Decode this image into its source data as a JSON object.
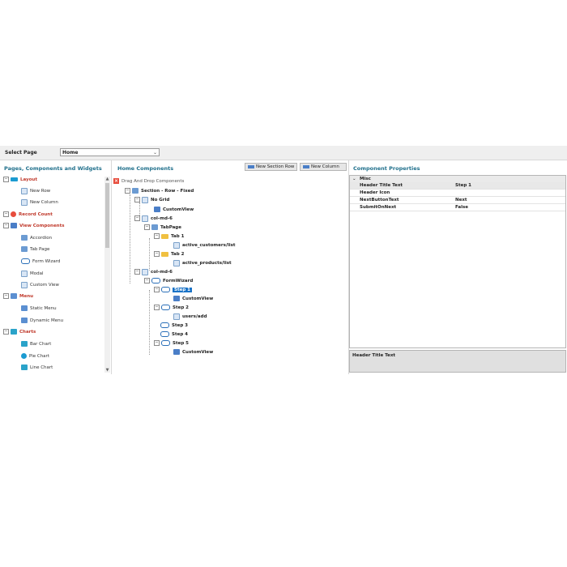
{
  "topbar": {
    "label": "Select Page",
    "select_value": "Home"
  },
  "left_panel": {
    "title": "Pages, Components and Widgets",
    "items": [
      {
        "label": "Layout",
        "kind": "cat",
        "icon": "layout-icon"
      },
      {
        "label": "New Row",
        "kind": "sub",
        "icon": "new-row-icon"
      },
      {
        "label": "New Column",
        "kind": "sub",
        "icon": "new-column-icon"
      },
      {
        "label": "Record Count",
        "kind": "cat",
        "icon": "record-count-icon"
      },
      {
        "label": "View Components",
        "kind": "cat",
        "icon": "view-components-icon"
      },
      {
        "label": "Accordion",
        "kind": "sub",
        "icon": "accordion-icon"
      },
      {
        "label": "Tab Page",
        "kind": "sub",
        "icon": "tab-page-icon"
      },
      {
        "label": "Form Wizard",
        "kind": "sub",
        "icon": "form-wizard-icon"
      },
      {
        "label": "Modal",
        "kind": "sub",
        "icon": "modal-icon"
      },
      {
        "label": "Custom View",
        "kind": "sub",
        "icon": "custom-view-icon"
      },
      {
        "label": "Menu",
        "kind": "cat",
        "icon": "menu-icon"
      },
      {
        "label": "Static Menu",
        "kind": "sub",
        "icon": "static-menu-icon"
      },
      {
        "label": "Dynamic Menu",
        "kind": "sub",
        "icon": "dynamic-menu-icon"
      },
      {
        "label": "Charts",
        "kind": "cat",
        "icon": "charts-icon"
      },
      {
        "label": "Bar Chart",
        "kind": "sub",
        "icon": "bar-chart-icon"
      },
      {
        "label": "Pie Chart",
        "kind": "sub",
        "icon": "pie-chart-icon"
      },
      {
        "label": "Line Chart",
        "kind": "sub",
        "icon": "line-chart-icon"
      }
    ]
  },
  "mid_panel": {
    "title": "Home Components",
    "new_section_row": "New Section Row",
    "new_column": "New Column",
    "drag_drop": "Drag And Drop Components",
    "tree": [
      {
        "label": "Section - Row - Fixed",
        "depth": 0
      },
      {
        "label": "No Grid",
        "depth": 1
      },
      {
        "label": "CustomView",
        "depth": 2
      },
      {
        "label": "col-md-6",
        "depth": 1
      },
      {
        "label": "TabPage",
        "depth": 2
      },
      {
        "label": "Tab 1",
        "depth": 3
      },
      {
        "label": "active_customers/list",
        "depth": 4
      },
      {
        "label": "Tab 2",
        "depth": 3
      },
      {
        "label": "active_products/list",
        "depth": 4
      },
      {
        "label": "col-md-6",
        "depth": 1
      },
      {
        "label": "FormWizard",
        "depth": 2
      },
      {
        "label": "Step 1",
        "depth": 3
      },
      {
        "label": "CustomView",
        "depth": 4
      },
      {
        "label": "Step 2",
        "depth": 3
      },
      {
        "label": "users/add",
        "depth": 4
      },
      {
        "label": "Step 3",
        "depth": 3
      },
      {
        "label": "Step 4",
        "depth": 3
      },
      {
        "label": "Step 5",
        "depth": 3
      },
      {
        "label": "CustomView",
        "depth": 4
      }
    ]
  },
  "right_panel": {
    "title": "Component Properties",
    "group": "Misc",
    "rows": [
      {
        "key": "Header Title Text",
        "value": "Step 1"
      },
      {
        "key": "Header Icon",
        "value": ""
      },
      {
        "key": "NextButtonText",
        "value": "Next"
      },
      {
        "key": "SubmitOnNext",
        "value": "False"
      }
    ],
    "description": "Header Title Text"
  }
}
